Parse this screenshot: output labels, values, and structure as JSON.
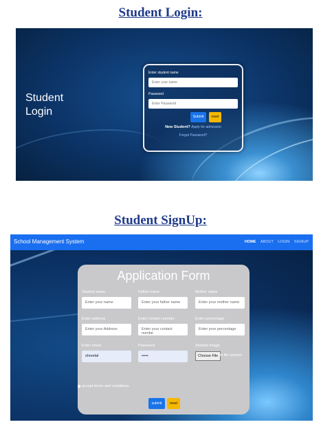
{
  "headings": {
    "login": "Student Login:",
    "signup": "Student SignUp:"
  },
  "login": {
    "side_title_line1": "Student",
    "side_title_line2": "Login",
    "name_label": "Enter student name",
    "name_placeholder": "Enter your name",
    "password_label": "Password",
    "password_placeholder": "Enter Password",
    "submit_label": "Submit",
    "reset_label": "reset",
    "new_student": "New Student?",
    "apply_link": "Apply for admission",
    "forgot_link": "Forgot Password?"
  },
  "signup": {
    "brand": "School Management System",
    "nav": [
      "HOME",
      "ABOUT",
      "LOGIN",
      "SIGNUP"
    ],
    "nav_active": "HOME",
    "form_title": "Application Form",
    "fields": {
      "student_name_label": "Student name",
      "student_name_placeholder": "Enter your name",
      "father_name_label": "Father name",
      "father_name_placeholder": "Enter your father name",
      "mother_name_label": "Mother name",
      "mother_name_placeholder": "Enter your mother name",
      "address_label": "Enter address",
      "address_placeholder": "Enter your Address",
      "contact_label": "Enter contact number",
      "contact_placeholder": "Enter your contact numbe",
      "percentage_label": "Enter percentage",
      "percentage_placeholder": "Enter your percentage",
      "email_label": "Enter email",
      "email_value": "shreelal",
      "password_label": "Password",
      "password_value": "•••••",
      "image_label": "Student Image",
      "choose_file": "Choose File",
      "no_file": "No file chosen"
    },
    "terms": "accept terms and conditions",
    "submit_label": "submit",
    "reset_label": "reset"
  }
}
